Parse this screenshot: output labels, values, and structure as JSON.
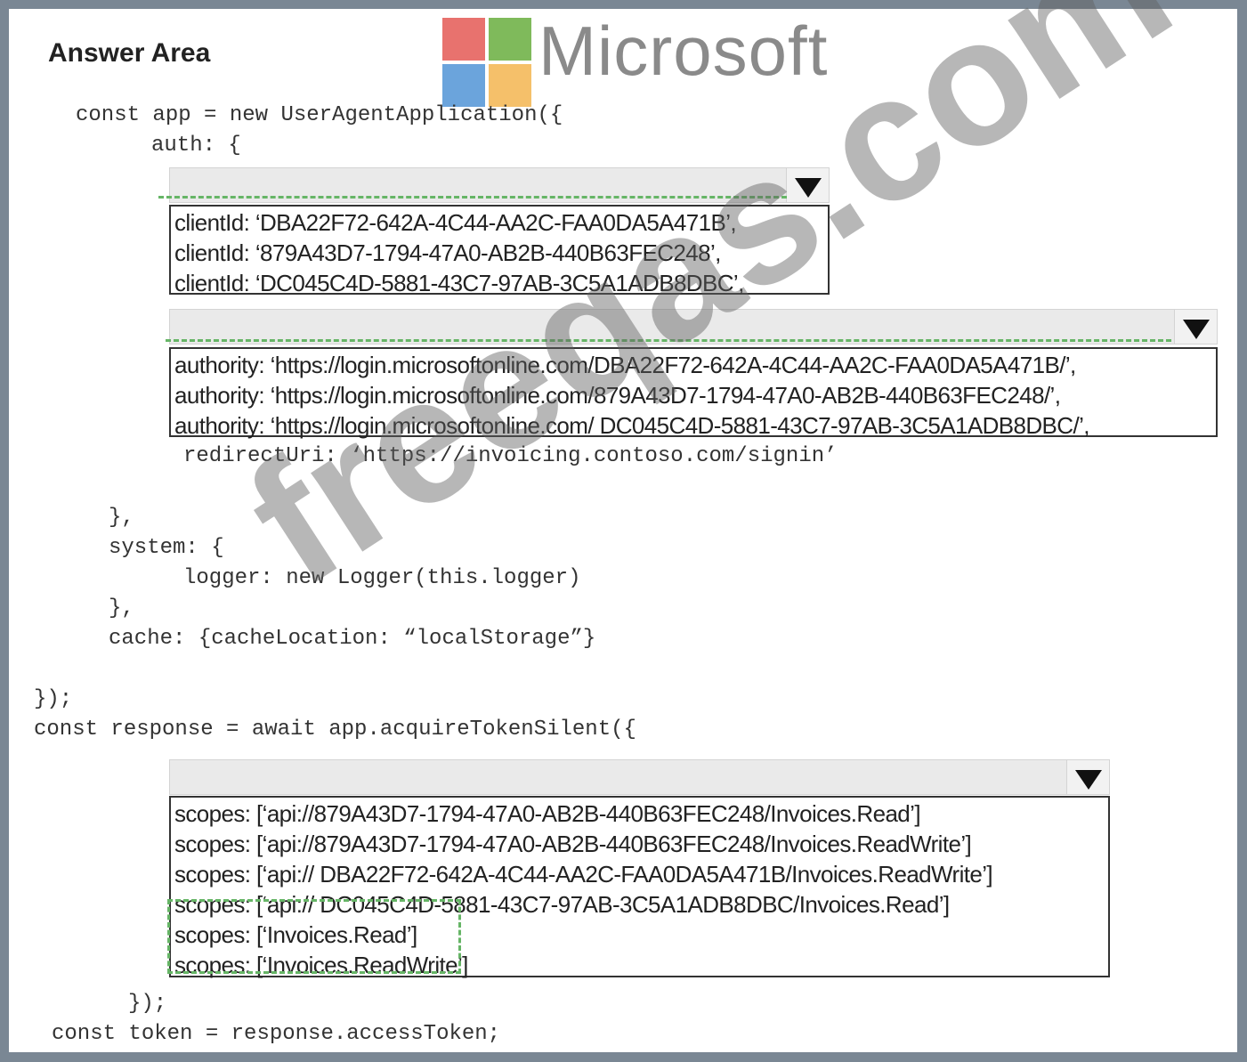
{
  "title": "Answer Area",
  "logo": {
    "text": "Microsoft",
    "tile_colors": [
      "#e8726e",
      "#7fba5b",
      "#6ba4dc",
      "#f5c06a"
    ]
  },
  "code": {
    "l1": "const app = new UserAgentApplication({",
    "l2": "auth: {",
    "redirect": "redirectUri: ‘https://invoicing.contoso.com/signin’",
    "l4": "},",
    "l5": "system: {",
    "l6": "logger: new Logger(this.logger)",
    "l7": "},",
    "l8": "cache: {cacheLocation: “localStorage”}",
    "l9": "});",
    "l10": "const response = await app.acquireTokenSilent({",
    "l11": "});",
    "l12": "const token = response.accessToken;"
  },
  "dropdowns": {
    "clientId": {
      "selected": "",
      "options": [
        "clientId: ‘DBA22F72-642A-4C44-AA2C-FAA0DA5A471B’,",
        "clientId: ‘879A43D7-1794-47A0-AB2B-440B63FEC248’,",
        "clientId: ‘DC045C4D-5881-43C7-97AB-3C5A1ADB8DBC’,"
      ]
    },
    "authority": {
      "selected": "",
      "options": [
        "authority: ‘https://login.microsoftonline.com/DBA22F72-642A-4C44-AA2C-FAA0DA5A471B/’,",
        "authority: ‘https://login.microsoftonline.com/879A43D7-1794-47A0-AB2B-440B63FEC248/’,",
        "authority: ‘https://login.microsoftonline.com/ DC045C4D-5881-43C7-97AB-3C5A1ADB8DBC/’,"
      ]
    },
    "scopes": {
      "selected": "",
      "options": [
        "scopes: [‘api://879A43D7-1794-47A0-AB2B-440B63FEC248/Invoices.Read’]",
        "scopes: [‘api://879A43D7-1794-47A0-AB2B-440B63FEC248/Invoices.ReadWrite’]",
        "scopes: [‘api:// DBA22F72-642A-4C44-AA2C-FAA0DA5A471B/Invoices.ReadWrite’]",
        "scopes: [‘api:// DC045C4D-5881-43C7-97AB-3C5A1ADB8DBC/Invoices.Read’]",
        "scopes: [‘Invoices.Read’]",
        "scopes: [‘Invoices.ReadWrite’]"
      ]
    }
  },
  "watermark": "freeqas.com"
}
